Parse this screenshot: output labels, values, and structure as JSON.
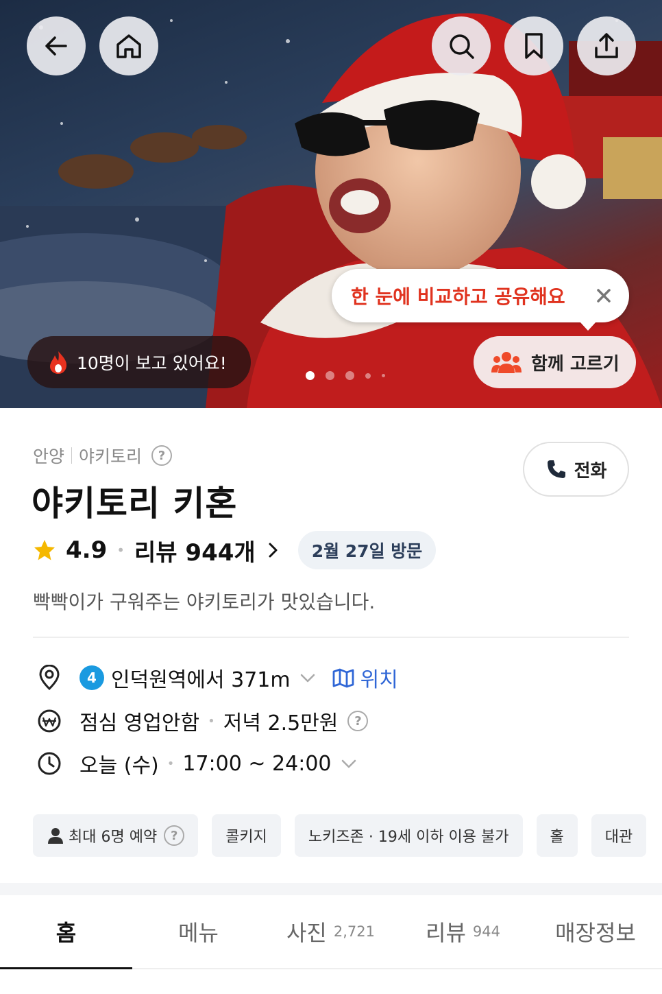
{
  "hero": {
    "viewing_text": "10명이 보고 있어요!",
    "tooltip_text": "한 눈에 비교하고 공유해요",
    "together_label": "함께 고르기",
    "carousel_total": 5,
    "carousel_active": 1
  },
  "store": {
    "region": "안양",
    "category": "야키토리",
    "name": "야키토리 키혼",
    "rating": "4.9",
    "reviews_label": "리뷰 944개",
    "visit_chip": "2월 27일 방문",
    "description": "빡빡이가 구워주는 야키토리가 맛있습니다.",
    "call_label": "전화"
  },
  "info": {
    "line_number": "4",
    "location_text": "인덕원역에서 371m",
    "location_link": "위치",
    "lunch": "점심 영업안함",
    "dinner": "저녁 2.5만원",
    "today": "오늘 (수)",
    "hours": "17:00 ~ 24:00"
  },
  "tags": [
    "최대 6명 예약",
    "콜키지",
    "노키즈존 · 19세 이하 이용 불가",
    "홀",
    "대관"
  ],
  "tabs": [
    {
      "label": "홈",
      "count": ""
    },
    {
      "label": "메뉴",
      "count": ""
    },
    {
      "label": "사진",
      "count": "2,721"
    },
    {
      "label": "리뷰",
      "count": "944"
    },
    {
      "label": "매장정보",
      "count": ""
    }
  ],
  "colors": {
    "accent_red": "#e0331f",
    "star": "#f5b800",
    "link_blue": "#2f66d6",
    "subway_line4": "#1a9ae0"
  }
}
